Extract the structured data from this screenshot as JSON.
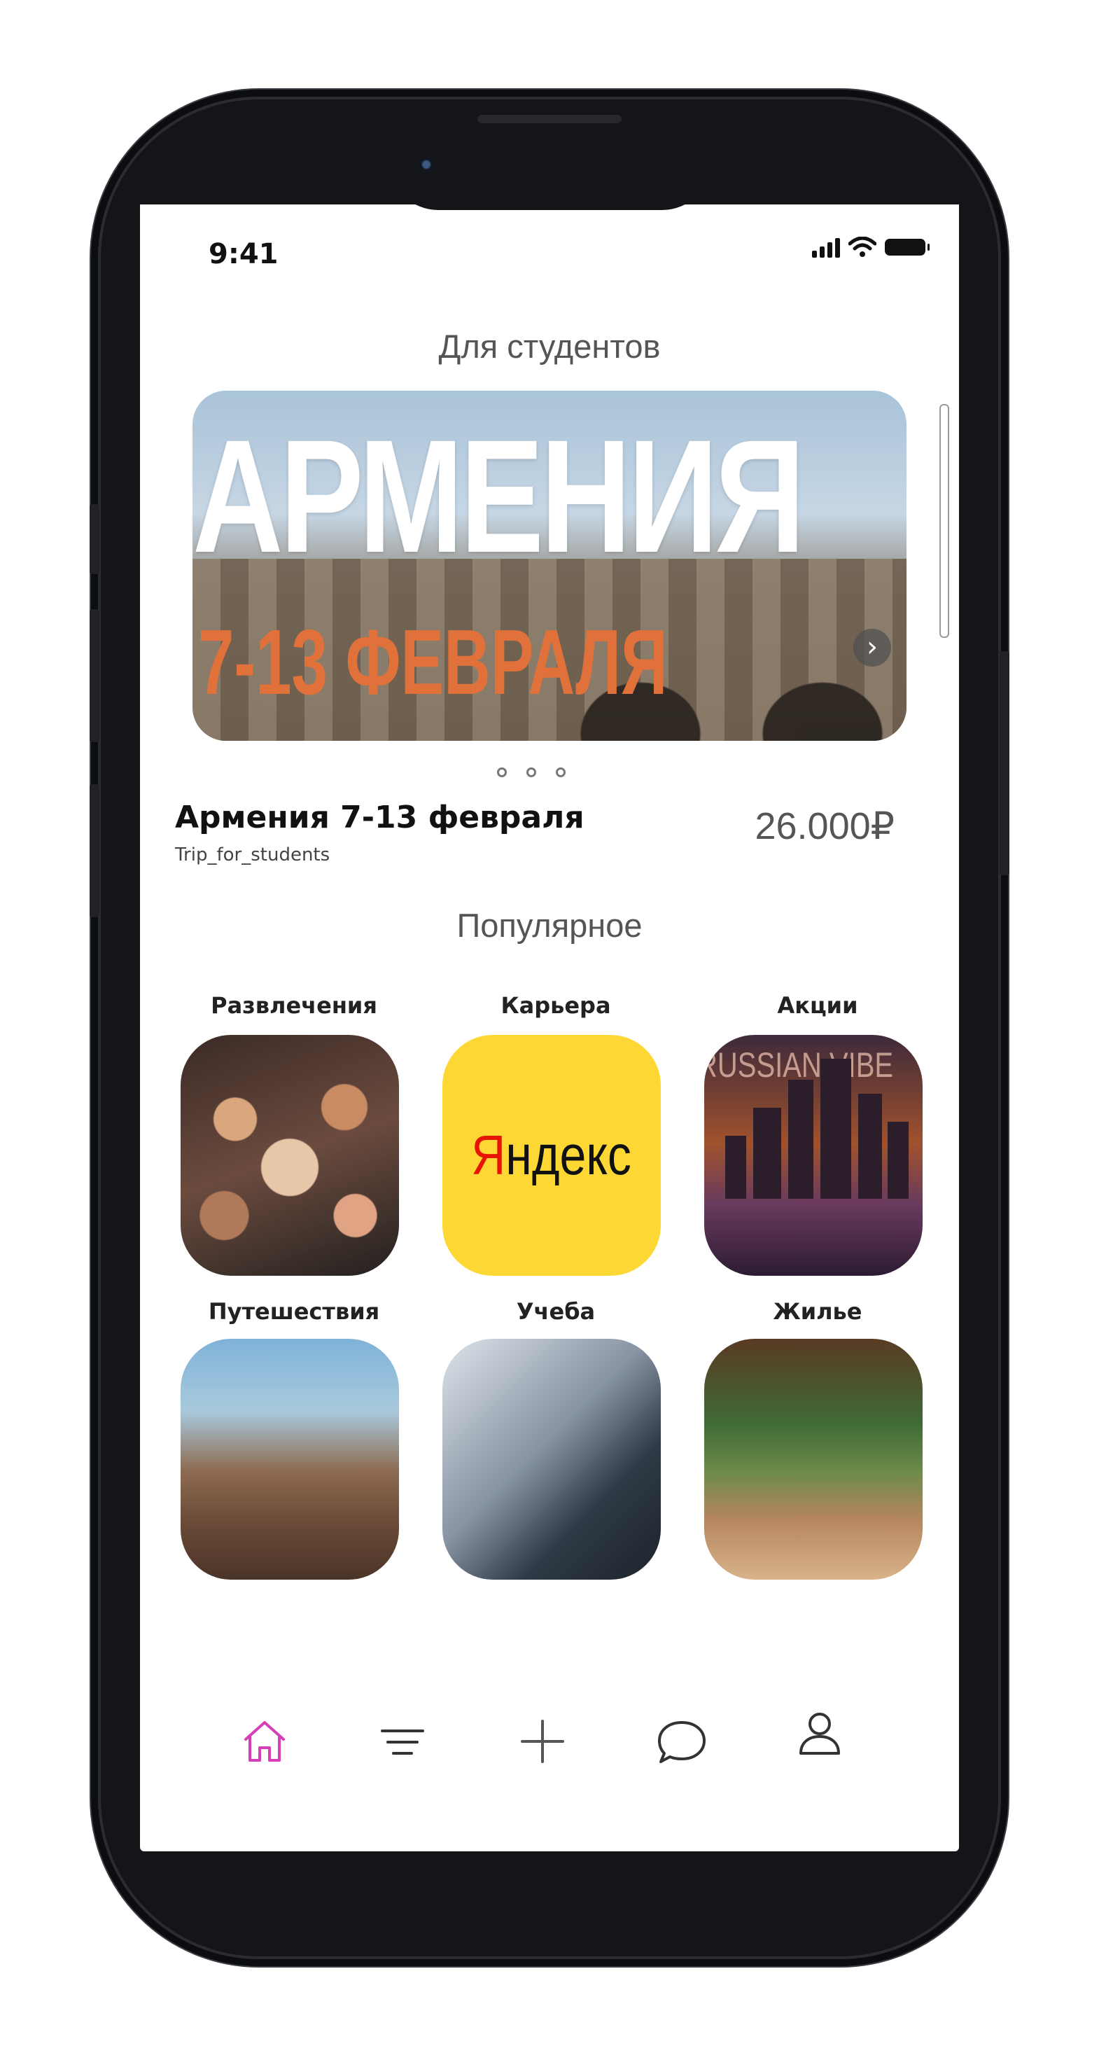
{
  "status_bar": {
    "time": "9:41"
  },
  "featured": {
    "section_title": "Для студентов",
    "banner_title": "АРМЕНИЯ",
    "banner_subtitle": "7-13 ФЕВРАЛЯ",
    "trip_name": "Армения 7-13 февраля",
    "organizer": "Trip_for_students",
    "price": "26.000₽",
    "carousel_dots": 3
  },
  "popular": {
    "section_title": "Популярное",
    "categories": [
      {
        "label": "Развлечения",
        "image": "crowd-party-photo"
      },
      {
        "label": "Карьера",
        "image": "yandex-logo",
        "logo_text_first": "Я",
        "logo_text_rest": "ндекс"
      },
      {
        "label": "Акции",
        "image": "city-skyline-photo",
        "overlay_text": "RUSSIAN VIBE"
      },
      {
        "label": "Путешествия",
        "image": "mountain-travelers-photo"
      },
      {
        "label": "Учеба",
        "image": "man-at-computer-photo"
      },
      {
        "label": "Жилье",
        "image": "cozy-room-photo"
      }
    ]
  },
  "nav": [
    {
      "icon": "home-icon",
      "active": true
    },
    {
      "icon": "filter-icon",
      "active": false
    },
    {
      "icon": "plus-icon",
      "active": false
    },
    {
      "icon": "chat-icon",
      "active": false
    },
    {
      "icon": "profile-icon",
      "active": false
    }
  ],
  "colors": {
    "accent": "#d63fb5",
    "price": "#555555",
    "banner_subtitle": "#e0713b",
    "yandex_bg": "#fdd835",
    "yandex_red": "#e61400"
  }
}
